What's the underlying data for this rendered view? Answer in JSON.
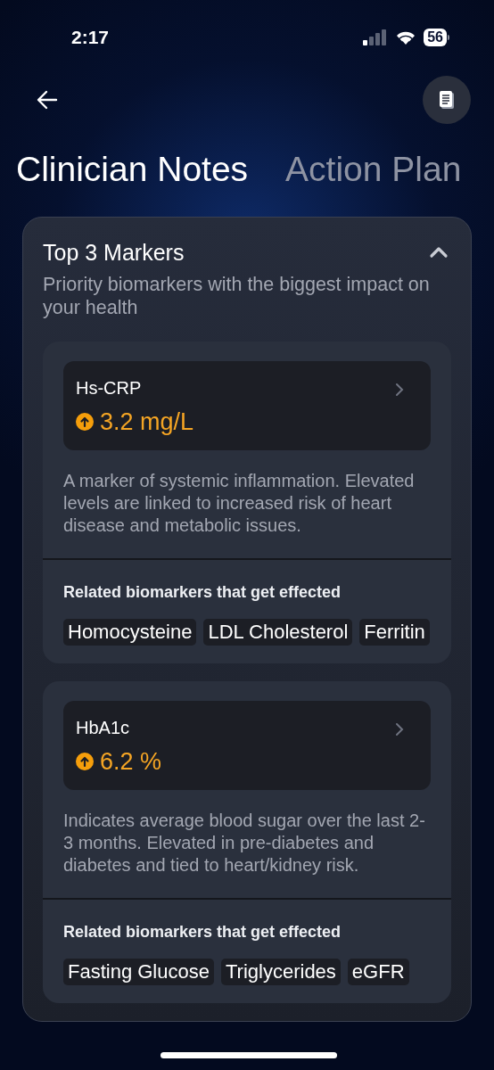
{
  "status_bar": {
    "time": "2:17",
    "battery": "56"
  },
  "tabs": [
    {
      "label": "Clinician Notes",
      "selected": true
    },
    {
      "label": "Action Plan",
      "selected": false
    }
  ],
  "section": {
    "title": "Top 3 Markers",
    "expanded": true,
    "subtitle": "Priority biomarkers with the biggest impact on your health",
    "markers": [
      {
        "name": "Hs-CRP",
        "value": "3.2 mg/L",
        "elevated": true,
        "description": "A marker of systemic inflammation. Elevated levels are linked to increased risk of heart disease and metabolic issues.",
        "related_title": "Related biomarkers that get effected",
        "related": [
          "Homocysteine",
          "LDL Cholesterol",
          "Ferritin"
        ]
      },
      {
        "name": "HbA1c",
        "value": "6.2 %",
        "elevated": true,
        "description": "Indicates average blood sugar over the last 2-3 months. Elevated in pre-diabetes and diabetes and tied to heart/kidney risk.",
        "related_title": "Related biomarkers that get effected",
        "related": [
          "Fasting Glucose",
          "Triglycerides",
          "eGFR"
        ]
      }
    ]
  }
}
